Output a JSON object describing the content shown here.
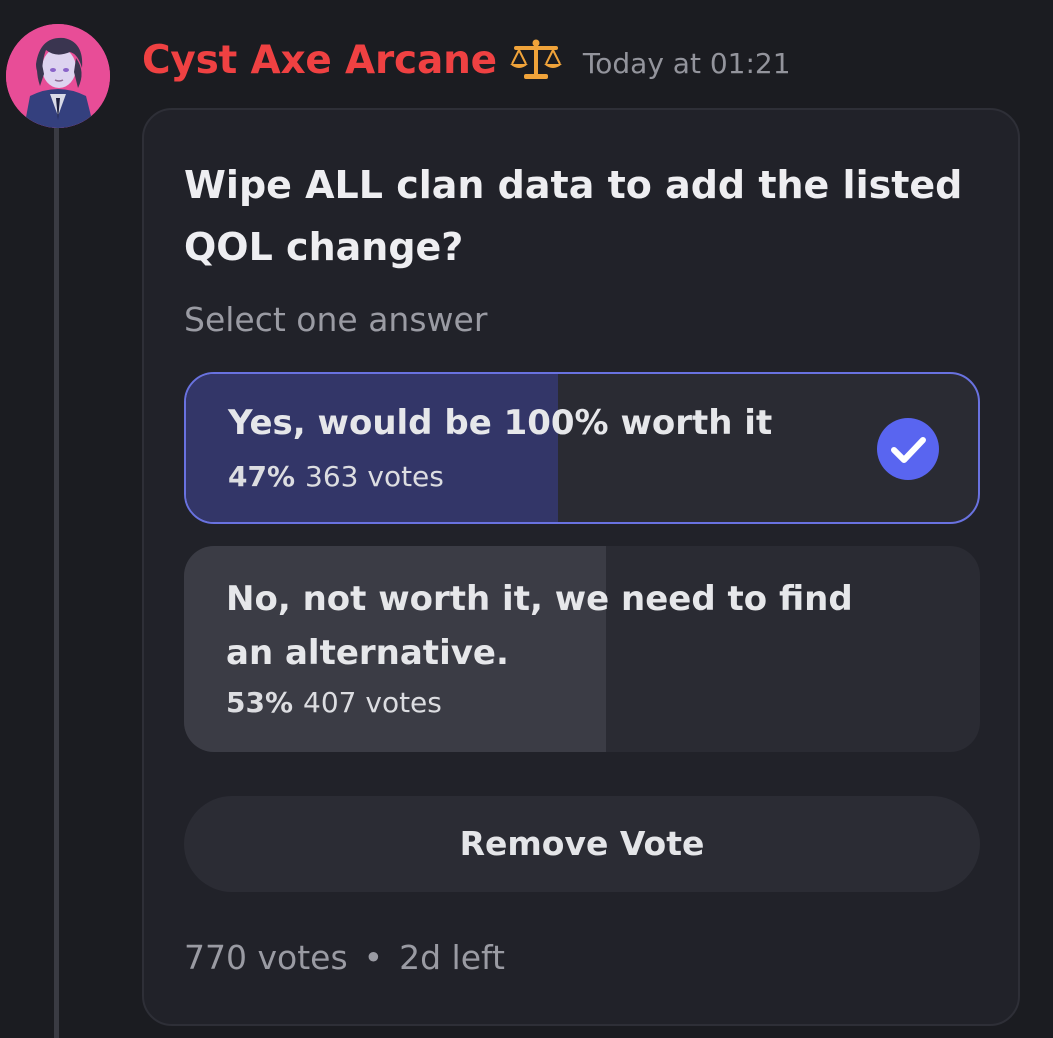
{
  "message": {
    "username": "Cyst Axe Arcane",
    "username_color": "#ef4142",
    "role_icon": "scales-icon",
    "timestamp": "Today at 01:21"
  },
  "poll": {
    "question": "Wipe ALL clan data to add the listed QOL change?",
    "instruction": "Select one answer",
    "accent_color": "#6972e0",
    "answers": [
      {
        "text": "Yes, would be 100% worth it",
        "percent_label": "47%",
        "percent": 47,
        "votes_label": "363 votes",
        "selected": true,
        "selected_icon": "check-circle-icon"
      },
      {
        "text": "No, not worth it, we need to find an alternative.",
        "percent_label": "53%",
        "percent": 53,
        "votes_label": "407 votes",
        "selected": false
      }
    ],
    "remove_vote_label": "Remove Vote",
    "total_votes": "770 votes",
    "separator": "•",
    "time_left": "2d left"
  }
}
